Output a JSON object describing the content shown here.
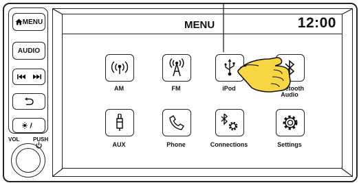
{
  "hardkeys": {
    "menu": "MENU",
    "audio": "AUDIO",
    "home_icon": "home-icon",
    "seek_back_icon": "seek-back-icon",
    "seek_forward_icon": "seek-forward-icon",
    "back_icon": "back-arrow-icon",
    "daynight_icon": "day-night-icon"
  },
  "knob": {
    "vol_label": "VOL",
    "push_label": "PUSH",
    "power_icon": "power-icon"
  },
  "screen": {
    "title": "MENU",
    "clock": "12:00",
    "apps": [
      {
        "label": "AM",
        "icon": "antenna-am-icon"
      },
      {
        "label": "FM",
        "icon": "antenna-fm-icon"
      },
      {
        "label": "iPod",
        "icon": "usb-icon"
      },
      {
        "label": "Bluetooth\nAudio",
        "icon": "bluetooth-audio-icon"
      },
      {
        "label": "AUX",
        "icon": "aux-jack-icon"
      },
      {
        "label": "Phone",
        "icon": "phone-icon"
      },
      {
        "label": "Connections",
        "icon": "bluetooth-settings-icon"
      },
      {
        "label": "Settings",
        "icon": "gear-icon"
      }
    ]
  },
  "pointer_icon": "hand-pointer-icon"
}
